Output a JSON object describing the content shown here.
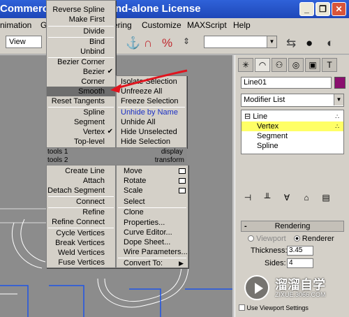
{
  "window": {
    "title_left": "Commerc",
    "title_right": "nd-alone License",
    "min_label": "_",
    "max_label": "❐",
    "close_label": "✕"
  },
  "menubar": {
    "items": [
      "nimation",
      "G",
      "ering",
      "Customize",
      "MAXScript",
      "Help"
    ]
  },
  "toolbar": {
    "view_label": "View",
    "combo_arrow": "▼"
  },
  "command_panel": {
    "object_name": "Line01",
    "modifier_list": "Modifier List",
    "stack": {
      "line": "Line",
      "vertex": "Vertex",
      "segment": "Segment",
      "spline": "Spline"
    },
    "rollout_title": "Rendering",
    "rollout_minus": "-",
    "viewport_radio": "Viewport",
    "renderer_radio": "Renderer",
    "thickness_label": "Thickness:",
    "thickness_value": "3.45",
    "sides_label": "Sides:",
    "sides_value": "4",
    "bottom_text": "Use Viewport Settings"
  },
  "quad_menu": {
    "top_left": [
      "Reverse Spline",
      "Make First",
      "Divide",
      "Bind",
      "Unbind",
      "Bezier Corner",
      "Bezier",
      "Corner",
      "Smooth",
      "Reset Tangents",
      "Spline",
      "Segment",
      "Vertex",
      "Top-level"
    ],
    "top_right": [
      "Isolate Selection",
      "Unfreeze All",
      "Freeze Selection",
      "Unhide by Name",
      "Unhide All",
      "Hide Unselected",
      "Hide Selection"
    ],
    "header1_left": "tools 1",
    "header1_right": "display",
    "header2_left": "tools 2",
    "header2_right": "transform",
    "bottom_left": [
      "Create Line",
      "Attach",
      "Detach Segment",
      "Connect",
      "Refine",
      "Refine Connect",
      "Cycle Vertices",
      "Break Vertices",
      "Weld Vertices",
      "Fuse Vertices"
    ],
    "bottom_right": [
      "Move",
      "Rotate",
      "Scale",
      "Select",
      "Clone",
      "Properties...",
      "Curve Editor...",
      "Dope Sheet...",
      "Wire Parameters...",
      "Convert To:"
    ],
    "checked": [
      "Bezier",
      "Vertex"
    ],
    "highlighted": "Smooth"
  },
  "watermark": {
    "title": "溜溜自学",
    "url": "ZIXUE.3066.COM"
  },
  "colors": {
    "title_bar": "#2f62d9",
    "menu_bg": "#d4d0c8",
    "highlight": "#6e6e6e",
    "stack_selection": "#ffff66",
    "annotation_arrow": "#e0141e",
    "object_color": "#8a0f6e",
    "viewport_bg": "#8c8c8c"
  }
}
